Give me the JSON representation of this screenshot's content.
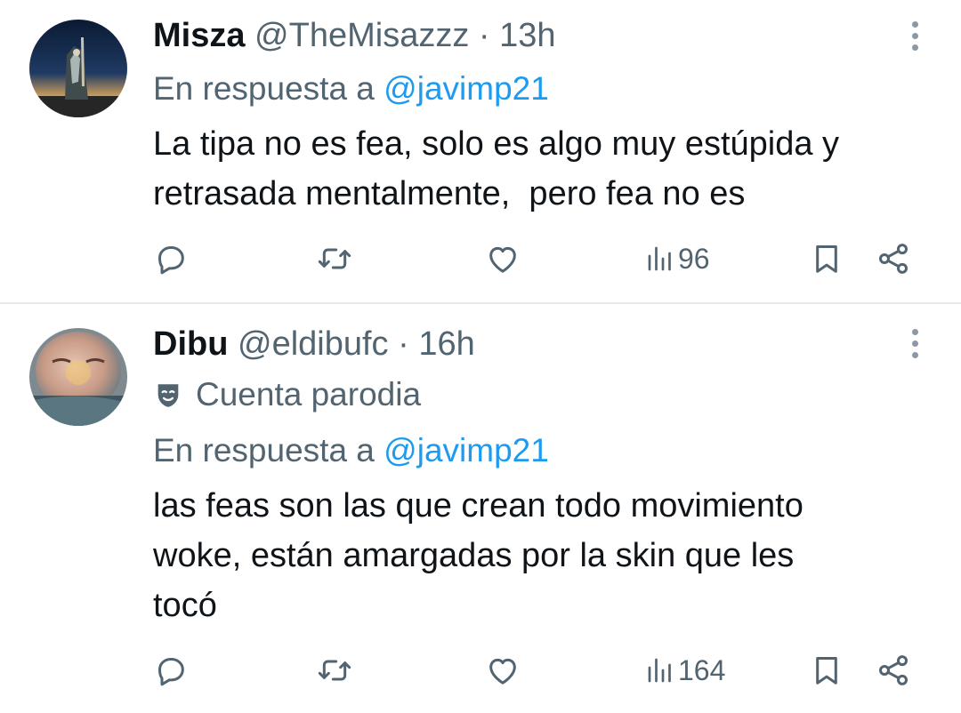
{
  "tweets": [
    {
      "author": {
        "name": "Misza",
        "handle": "@TheMisazzz",
        "separator": "·",
        "time": "13h"
      },
      "badge": null,
      "reply_to": {
        "prefix": "En respuesta a",
        "mention": "@javimp21"
      },
      "text": "La tipa no es fea, solo es algo muy estúpida y\nretrasada mentalmente,  pero fea no es",
      "stats": {
        "views": "96"
      },
      "icons": [
        "reply-icon",
        "retweet-icon",
        "like-icon",
        "views-icon",
        "bookmark-icon",
        "share-icon",
        "more-icon"
      ]
    },
    {
      "author": {
        "name": "Dibu",
        "handle": "@eldibufc",
        "separator": "·",
        "time": "16h"
      },
      "badge": {
        "label": "Cuenta parodia",
        "icon": "parody-mask-icon"
      },
      "reply_to": {
        "prefix": "En respuesta a",
        "mention": "@javimp21"
      },
      "text": "las feas son las que crean todo movimiento\nwoke, están amargadas por la skin que les\ntocó",
      "stats": {
        "views": "164"
      },
      "icons": [
        "reply-icon",
        "retweet-icon",
        "like-icon",
        "views-icon",
        "bookmark-icon",
        "share-icon",
        "more-icon"
      ]
    }
  ],
  "colors": {
    "text": "#0f1419",
    "secondary": "#536471",
    "link": "#1d9bf0",
    "divider": "#e6ebee",
    "background": "#ffffff"
  }
}
